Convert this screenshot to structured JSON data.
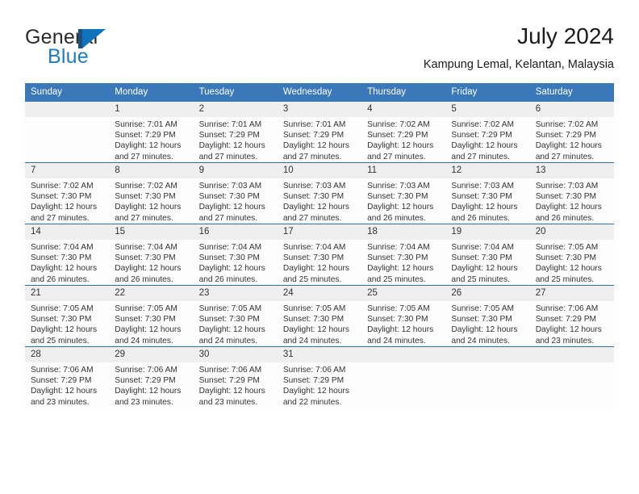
{
  "brand": {
    "name_top": "General",
    "name_bottom": "Blue",
    "color_dark": "#2b2b2b",
    "color_blue": "#1e7cc4",
    "mark_bar_color": "#1d4f80",
    "mark_triangle_color": "#1173bd"
  },
  "header": {
    "title": "July 2024",
    "location": "Kampung Lemal, Kelantan, Malaysia"
  },
  "theme": {
    "header_row_color": "#3a78b9",
    "day_band_color": "#efefef",
    "row_divider_color": "#2f6fae",
    "text_color": "#333333"
  },
  "weekdays": [
    "Sunday",
    "Monday",
    "Tuesday",
    "Wednesday",
    "Thursday",
    "Friday",
    "Saturday"
  ],
  "weeks": [
    [
      {
        "day": "",
        "sunrise": "",
        "sunset": "",
        "daylight_1": "",
        "daylight_2": "",
        "empty": true
      },
      {
        "day": "1",
        "sunrise": "Sunrise: 7:01 AM",
        "sunset": "Sunset: 7:29 PM",
        "daylight_1": "Daylight: 12 hours",
        "daylight_2": "and 27 minutes.",
        "empty": false
      },
      {
        "day": "2",
        "sunrise": "Sunrise: 7:01 AM",
        "sunset": "Sunset: 7:29 PM",
        "daylight_1": "Daylight: 12 hours",
        "daylight_2": "and 27 minutes.",
        "empty": false
      },
      {
        "day": "3",
        "sunrise": "Sunrise: 7:01 AM",
        "sunset": "Sunset: 7:29 PM",
        "daylight_1": "Daylight: 12 hours",
        "daylight_2": "and 27 minutes.",
        "empty": false
      },
      {
        "day": "4",
        "sunrise": "Sunrise: 7:02 AM",
        "sunset": "Sunset: 7:29 PM",
        "daylight_1": "Daylight: 12 hours",
        "daylight_2": "and 27 minutes.",
        "empty": false
      },
      {
        "day": "5",
        "sunrise": "Sunrise: 7:02 AM",
        "sunset": "Sunset: 7:29 PM",
        "daylight_1": "Daylight: 12 hours",
        "daylight_2": "and 27 minutes.",
        "empty": false
      },
      {
        "day": "6",
        "sunrise": "Sunrise: 7:02 AM",
        "sunset": "Sunset: 7:29 PM",
        "daylight_1": "Daylight: 12 hours",
        "daylight_2": "and 27 minutes.",
        "empty": false
      }
    ],
    [
      {
        "day": "7",
        "sunrise": "Sunrise: 7:02 AM",
        "sunset": "Sunset: 7:30 PM",
        "daylight_1": "Daylight: 12 hours",
        "daylight_2": "and 27 minutes.",
        "empty": false
      },
      {
        "day": "8",
        "sunrise": "Sunrise: 7:02 AM",
        "sunset": "Sunset: 7:30 PM",
        "daylight_1": "Daylight: 12 hours",
        "daylight_2": "and 27 minutes.",
        "empty": false
      },
      {
        "day": "9",
        "sunrise": "Sunrise: 7:03 AM",
        "sunset": "Sunset: 7:30 PM",
        "daylight_1": "Daylight: 12 hours",
        "daylight_2": "and 27 minutes.",
        "empty": false
      },
      {
        "day": "10",
        "sunrise": "Sunrise: 7:03 AM",
        "sunset": "Sunset: 7:30 PM",
        "daylight_1": "Daylight: 12 hours",
        "daylight_2": "and 27 minutes.",
        "empty": false
      },
      {
        "day": "11",
        "sunrise": "Sunrise: 7:03 AM",
        "sunset": "Sunset: 7:30 PM",
        "daylight_1": "Daylight: 12 hours",
        "daylight_2": "and 26 minutes.",
        "empty": false
      },
      {
        "day": "12",
        "sunrise": "Sunrise: 7:03 AM",
        "sunset": "Sunset: 7:30 PM",
        "daylight_1": "Daylight: 12 hours",
        "daylight_2": "and 26 minutes.",
        "empty": false
      },
      {
        "day": "13",
        "sunrise": "Sunrise: 7:03 AM",
        "sunset": "Sunset: 7:30 PM",
        "daylight_1": "Daylight: 12 hours",
        "daylight_2": "and 26 minutes.",
        "empty": false
      }
    ],
    [
      {
        "day": "14",
        "sunrise": "Sunrise: 7:04 AM",
        "sunset": "Sunset: 7:30 PM",
        "daylight_1": "Daylight: 12 hours",
        "daylight_2": "and 26 minutes.",
        "empty": false
      },
      {
        "day": "15",
        "sunrise": "Sunrise: 7:04 AM",
        "sunset": "Sunset: 7:30 PM",
        "daylight_1": "Daylight: 12 hours",
        "daylight_2": "and 26 minutes.",
        "empty": false
      },
      {
        "day": "16",
        "sunrise": "Sunrise: 7:04 AM",
        "sunset": "Sunset: 7:30 PM",
        "daylight_1": "Daylight: 12 hours",
        "daylight_2": "and 26 minutes.",
        "empty": false
      },
      {
        "day": "17",
        "sunrise": "Sunrise: 7:04 AM",
        "sunset": "Sunset: 7:30 PM",
        "daylight_1": "Daylight: 12 hours",
        "daylight_2": "and 25 minutes.",
        "empty": false
      },
      {
        "day": "18",
        "sunrise": "Sunrise: 7:04 AM",
        "sunset": "Sunset: 7:30 PM",
        "daylight_1": "Daylight: 12 hours",
        "daylight_2": "and 25 minutes.",
        "empty": false
      },
      {
        "day": "19",
        "sunrise": "Sunrise: 7:04 AM",
        "sunset": "Sunset: 7:30 PM",
        "daylight_1": "Daylight: 12 hours",
        "daylight_2": "and 25 minutes.",
        "empty": false
      },
      {
        "day": "20",
        "sunrise": "Sunrise: 7:05 AM",
        "sunset": "Sunset: 7:30 PM",
        "daylight_1": "Daylight: 12 hours",
        "daylight_2": "and 25 minutes.",
        "empty": false
      }
    ],
    [
      {
        "day": "21",
        "sunrise": "Sunrise: 7:05 AM",
        "sunset": "Sunset: 7:30 PM",
        "daylight_1": "Daylight: 12 hours",
        "daylight_2": "and 25 minutes.",
        "empty": false
      },
      {
        "day": "22",
        "sunrise": "Sunrise: 7:05 AM",
        "sunset": "Sunset: 7:30 PM",
        "daylight_1": "Daylight: 12 hours",
        "daylight_2": "and 24 minutes.",
        "empty": false
      },
      {
        "day": "23",
        "sunrise": "Sunrise: 7:05 AM",
        "sunset": "Sunset: 7:30 PM",
        "daylight_1": "Daylight: 12 hours",
        "daylight_2": "and 24 minutes.",
        "empty": false
      },
      {
        "day": "24",
        "sunrise": "Sunrise: 7:05 AM",
        "sunset": "Sunset: 7:30 PM",
        "daylight_1": "Daylight: 12 hours",
        "daylight_2": "and 24 minutes.",
        "empty": false
      },
      {
        "day": "25",
        "sunrise": "Sunrise: 7:05 AM",
        "sunset": "Sunset: 7:30 PM",
        "daylight_1": "Daylight: 12 hours",
        "daylight_2": "and 24 minutes.",
        "empty": false
      },
      {
        "day": "26",
        "sunrise": "Sunrise: 7:05 AM",
        "sunset": "Sunset: 7:30 PM",
        "daylight_1": "Daylight: 12 hours",
        "daylight_2": "and 24 minutes.",
        "empty": false
      },
      {
        "day": "27",
        "sunrise": "Sunrise: 7:06 AM",
        "sunset": "Sunset: 7:29 PM",
        "daylight_1": "Daylight: 12 hours",
        "daylight_2": "and 23 minutes.",
        "empty": false
      }
    ],
    [
      {
        "day": "28",
        "sunrise": "Sunrise: 7:06 AM",
        "sunset": "Sunset: 7:29 PM",
        "daylight_1": "Daylight: 12 hours",
        "daylight_2": "and 23 minutes.",
        "empty": false
      },
      {
        "day": "29",
        "sunrise": "Sunrise: 7:06 AM",
        "sunset": "Sunset: 7:29 PM",
        "daylight_1": "Daylight: 12 hours",
        "daylight_2": "and 23 minutes.",
        "empty": false
      },
      {
        "day": "30",
        "sunrise": "Sunrise: 7:06 AM",
        "sunset": "Sunset: 7:29 PM",
        "daylight_1": "Daylight: 12 hours",
        "daylight_2": "and 23 minutes.",
        "empty": false
      },
      {
        "day": "31",
        "sunrise": "Sunrise: 7:06 AM",
        "sunset": "Sunset: 7:29 PM",
        "daylight_1": "Daylight: 12 hours",
        "daylight_2": "and 22 minutes.",
        "empty": false
      },
      {
        "day": "",
        "sunrise": "",
        "sunset": "",
        "daylight_1": "",
        "daylight_2": "",
        "empty": true
      },
      {
        "day": "",
        "sunrise": "",
        "sunset": "",
        "daylight_1": "",
        "daylight_2": "",
        "empty": true
      },
      {
        "day": "",
        "sunrise": "",
        "sunset": "",
        "daylight_1": "",
        "daylight_2": "",
        "empty": true
      }
    ]
  ]
}
